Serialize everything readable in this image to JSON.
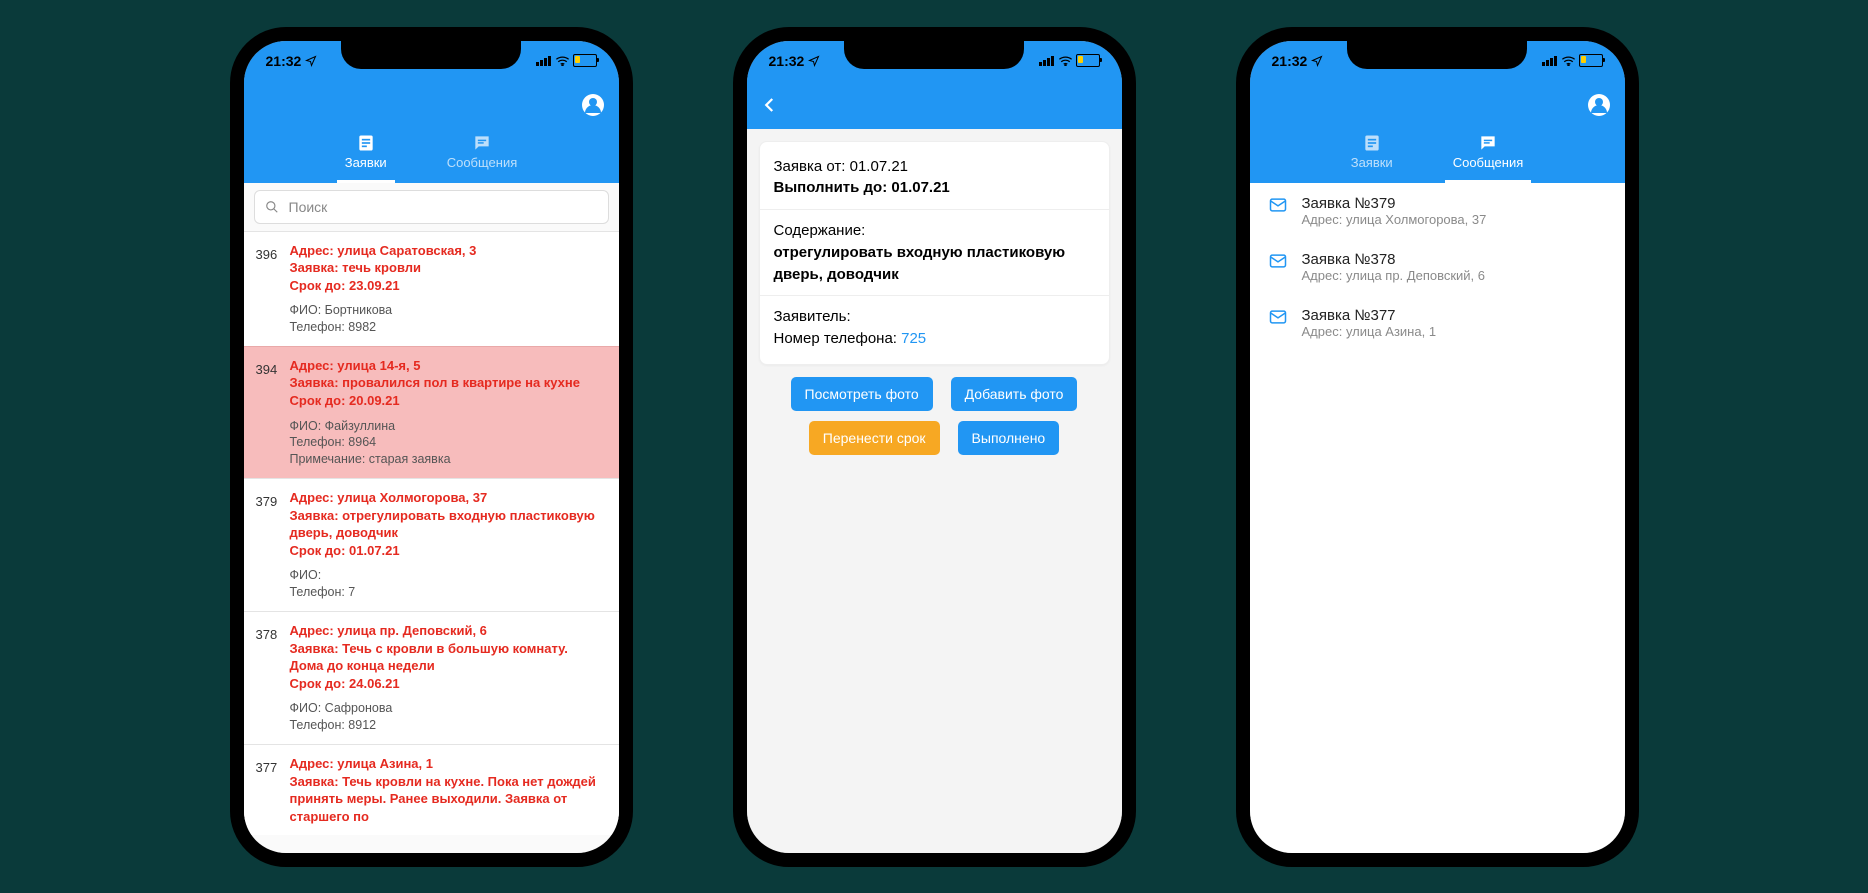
{
  "status": {
    "time": "21:32"
  },
  "tabs": {
    "requests": "Заявки",
    "messages": "Сообщения"
  },
  "search": {
    "placeholder": "Поиск"
  },
  "requests": [
    {
      "id": "396",
      "highlight": false,
      "address": "Адрес: улица Саратовская, 3",
      "title": "Заявка: течь кровли",
      "due": "Срок до: 23.09.21",
      "fio": "ФИО: Бортникова",
      "phone": "Телефон: 8982",
      "note": ""
    },
    {
      "id": "394",
      "highlight": true,
      "address": "Адрес: улица 14-я, 5",
      "title": "Заявка: провалился пол в квартире на кухне",
      "due": "Срок до: 20.09.21",
      "fio": "ФИО: Файзуллина",
      "phone": "Телефон: 8964",
      "note": "Примечание: старая заявка"
    },
    {
      "id": "379",
      "highlight": false,
      "address": "Адрес: улица Холмогорова, 37",
      "title": "Заявка: отрегулировать входную пластиковую дверь, доводчик",
      "due": "Срок до: 01.07.21",
      "fio": "ФИО:",
      "phone": "Телефон: 7",
      "note": ""
    },
    {
      "id": "378",
      "highlight": false,
      "address": "Адрес: улица пр. Деповский, 6",
      "title": "Заявка: Течь с кровли в большую комнату. Дома до конца недели",
      "due": "Срок до: 24.06.21",
      "fio": "ФИО: Сафронова",
      "phone": "Телефон: 8912",
      "note": ""
    },
    {
      "id": "377",
      "highlight": false,
      "address": "Адрес: улица Азина, 1",
      "title": "Заявка: Течь кровли на кухне. Пока нет дождей принять меры. Ранее выходили. Заявка от старшего по",
      "due": "",
      "fio": "",
      "phone": "",
      "note": ""
    }
  ],
  "detail": {
    "from_label": "Заявка от: ",
    "from_value": "01.07.21",
    "due_label": "Выполнить до: ",
    "due_value": "01.07.21",
    "content_label": "Содержание:",
    "content_value": "отрегулировать входную пластиковую дверь, доводчик",
    "applicant_label": "Заявитель:",
    "phone_label": "Номер телефона: ",
    "phone_value": "725",
    "btn_view": "Посмотреть фото",
    "btn_add": "Добавить фото",
    "btn_reschedule": "Перенести срок",
    "btn_done": "Выполнено"
  },
  "messages": [
    {
      "title": "Заявка №379",
      "addr": "Адрес: улица Холмогорова, 37"
    },
    {
      "title": "Заявка №378",
      "addr": "Адрес: улица пр. Деповский, 6"
    },
    {
      "title": "Заявка №377",
      "addr": "Адрес: улица Азина, 1"
    }
  ]
}
